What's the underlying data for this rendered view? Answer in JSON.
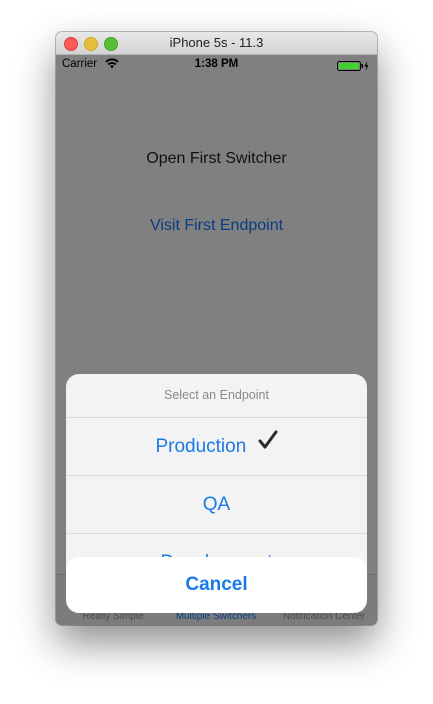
{
  "window": {
    "title": "iPhone 5s - 11.3"
  },
  "status_bar": {
    "carrier": "Carrier",
    "time": "1:38 PM",
    "wifi_icon": "wifi-icon",
    "battery_icon": "battery-charging-icon"
  },
  "main": {
    "heading": "Open First Switcher",
    "link": "Visit First Endpoint"
  },
  "tab_bar": {
    "items": [
      {
        "label": "Really Simple"
      },
      {
        "label": "Multiple Switchers"
      },
      {
        "label": "Notification Center"
      }
    ],
    "selected": "Multiple Switchers"
  },
  "action_sheet": {
    "title": "Select an Endpoint",
    "options": [
      {
        "label": "Production",
        "checked": true
      },
      {
        "label": "QA",
        "checked": false
      },
      {
        "label": "Development",
        "checked": false
      }
    ],
    "cancel_label": "Cancel"
  },
  "colors": {
    "accent": "#1a7ae6",
    "dim_background": "#808080",
    "link": "#0a3c80"
  }
}
